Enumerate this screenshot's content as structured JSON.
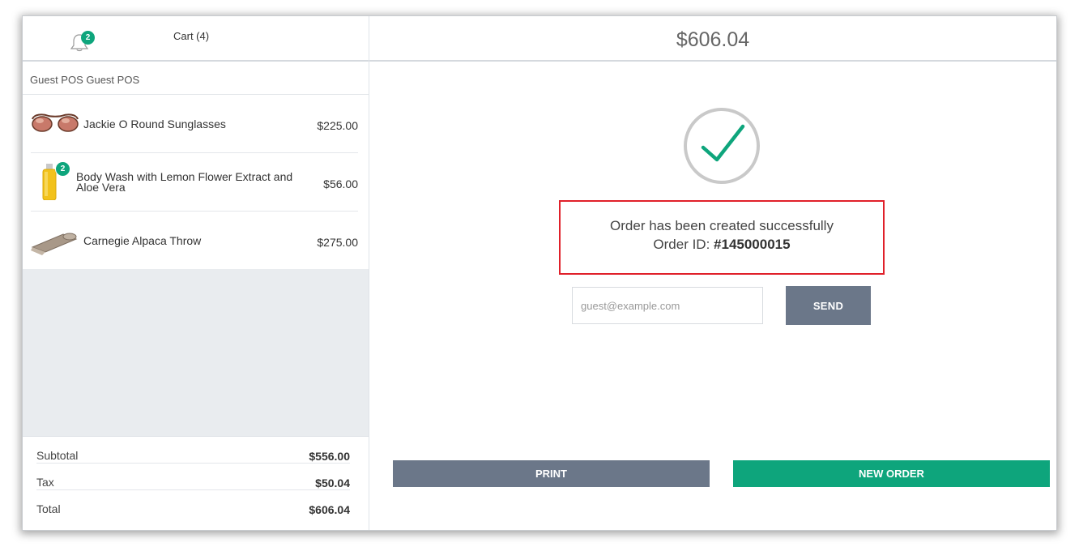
{
  "cart": {
    "title": "Cart (4)",
    "notification_count": "2",
    "customer": "Guest POS Guest POS",
    "items": [
      {
        "name": "Jackie O Round Sunglasses",
        "price": "$225.00",
        "icon": "sunglasses-image"
      },
      {
        "name_line1": "Body Wash with Lemon Flower Extract and",
        "name_line2": "Aloe Vera",
        "price": "$56.00",
        "quantity": "2",
        "icon": "body-wash-bottle-image"
      },
      {
        "name": "Carnegie Alpaca Throw",
        "price": "$275.00",
        "icon": "rolled-throw-image"
      }
    ],
    "totals": [
      {
        "label": "Subtotal",
        "value": "$556.00"
      },
      {
        "label": "Tax",
        "value": "$50.04"
      },
      {
        "label": "Total",
        "value": "$606.04"
      }
    ]
  },
  "order": {
    "total": "$606.04",
    "success_message": "Order has been created successfully",
    "order_id_label": "Order ID: ",
    "order_id": "#145000015",
    "email_placeholder": "guest@example.com",
    "send_label": "SEND",
    "print_label": "PRINT",
    "new_order_label": "NEW ORDER"
  },
  "colors": {
    "accent": "#0ea57c",
    "button_gray": "#6b7789",
    "highlight_border": "#e0202a"
  }
}
